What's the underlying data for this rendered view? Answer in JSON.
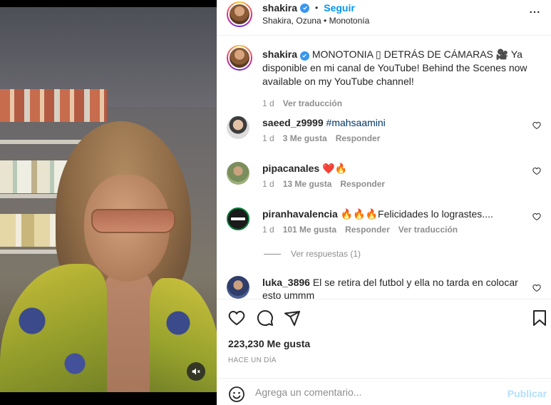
{
  "post": {
    "author": "shakira",
    "follow_label": "Seguir",
    "separator": "•",
    "audio": "Shakira, Ozuna • Monotonía"
  },
  "caption": {
    "username": "shakira",
    "text": "MONOTONIA ▯ DETRÁS DE CÁMARAS 🎥 Ya disponible en mi canal de YouTube! Behind the Scenes now available on my YouTube channel!",
    "age": "1 d",
    "translate": "Ver traducción"
  },
  "comments": [
    {
      "username": "saeed_z9999",
      "text": "",
      "hashtag": "#mahsaamini",
      "age": "1 d",
      "likes": "3 Me gusta",
      "reply": "Responder",
      "translate": ""
    },
    {
      "username": "pipacanales",
      "text": "❤️🔥",
      "hashtag": "",
      "age": "1 d",
      "likes": "13 Me gusta",
      "reply": "Responder",
      "translate": ""
    },
    {
      "username": "piranhavalencia",
      "text": "🔥🔥🔥Felicidades lo lograstes....",
      "hashtag": "",
      "age": "1 d",
      "likes": "101 Me gusta",
      "reply": "Responder",
      "translate": "Ver traducción"
    },
    {
      "username": "luka_3896",
      "text": "El se retira del futbol y ella no tarda en colocar esto ummm",
      "hashtag": "",
      "age": "",
      "likes": "",
      "reply": "",
      "translate": ""
    }
  ],
  "view_replies": "Ver respuestas (1)",
  "stats": {
    "likes": "223,230 Me gusta",
    "when": "HACE UN DÍA"
  },
  "composer": {
    "placeholder": "Agrega un comentario...",
    "publish": "Publicar"
  },
  "colors": {
    "accent": "#0095f6",
    "verified": "#3897f0",
    "publish_disabled": "#b2dffc",
    "secondary_text": "#8e8e8e"
  },
  "icons": {
    "verified": "verified-badge-icon",
    "more": "more-horizontal-icon",
    "like": "heart-icon",
    "comment": "comment-icon",
    "share": "send-icon",
    "save": "bookmark-icon",
    "emoji": "emoji-icon",
    "mute": "audio-muted-icon"
  }
}
